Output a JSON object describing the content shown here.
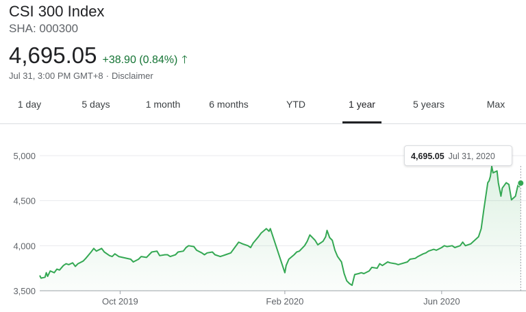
{
  "header": {
    "title": "CSI 300 Index",
    "ticker": "SHA: 000300",
    "price": "4,695.05",
    "change": "+38.90 (0.84%)",
    "timestamp": "Jul 31, 3:00 PM GMT+8",
    "separator": "·",
    "disclaimer": "Disclaimer"
  },
  "tabs": [
    {
      "label": "1 day",
      "active": false
    },
    {
      "label": "5 days",
      "active": false
    },
    {
      "label": "1 month",
      "active": false
    },
    {
      "label": "6 months",
      "active": false
    },
    {
      "label": "YTD",
      "active": false
    },
    {
      "label": "1 year",
      "active": true
    },
    {
      "label": "5 years",
      "active": false
    },
    {
      "label": "Max",
      "active": false
    }
  ],
  "tooltip": {
    "value": "4,695.05",
    "date": "Jul 31, 2020"
  },
  "colors": {
    "line": "#34a853",
    "positive": "#137333"
  },
  "chart_data": {
    "type": "area",
    "ylim": [
      3500,
      5000
    ],
    "y_ticks": [
      {
        "value": 5000,
        "label": "5,000"
      },
      {
        "value": 4500,
        "label": "4,500"
      },
      {
        "value": 4000,
        "label": "4,000"
      },
      {
        "value": 3500,
        "label": "3,500"
      }
    ],
    "x_range": [
      "2019-08-01",
      "2020-08-04"
    ],
    "x_ticks": [
      {
        "date": "2019-10-01",
        "label": "Oct 2019"
      },
      {
        "date": "2020-02-03",
        "label": "Feb 2020"
      },
      {
        "date": "2020-06-01",
        "label": "Jun 2020"
      }
    ],
    "grid": true,
    "series": [
      {
        "points": [
          [
            "2019-08-01",
            3670
          ],
          [
            "2019-08-02",
            3640
          ],
          [
            "2019-08-05",
            3650
          ],
          [
            "2019-08-06",
            3700
          ],
          [
            "2019-08-07",
            3660
          ],
          [
            "2019-08-09",
            3720
          ],
          [
            "2019-08-12",
            3700
          ],
          [
            "2019-08-14",
            3740
          ],
          [
            "2019-08-16",
            3730
          ],
          [
            "2019-08-19",
            3780
          ],
          [
            "2019-08-21",
            3800
          ],
          [
            "2019-08-23",
            3790
          ],
          [
            "2019-08-26",
            3810
          ],
          [
            "2019-08-28",
            3770
          ],
          [
            "2019-08-30",
            3800
          ],
          [
            "2019-09-03",
            3830
          ],
          [
            "2019-09-05",
            3860
          ],
          [
            "2019-09-09",
            3930
          ],
          [
            "2019-09-11",
            3970
          ],
          [
            "2019-09-13",
            3940
          ],
          [
            "2019-09-17",
            3970
          ],
          [
            "2019-09-19",
            3930
          ],
          [
            "2019-09-23",
            3890
          ],
          [
            "2019-09-25",
            3880
          ],
          [
            "2019-09-27",
            3910
          ],
          [
            "2019-09-30",
            3880
          ],
          [
            "2019-10-09",
            3850
          ],
          [
            "2019-10-11",
            3820
          ],
          [
            "2019-10-15",
            3850
          ],
          [
            "2019-10-17",
            3880
          ],
          [
            "2019-10-21",
            3870
          ],
          [
            "2019-10-23",
            3900
          ],
          [
            "2019-10-25",
            3930
          ],
          [
            "2019-10-29",
            3940
          ],
          [
            "2019-10-31",
            3890
          ],
          [
            "2019-11-04",
            3900
          ],
          [
            "2019-11-06",
            3900
          ],
          [
            "2019-11-08",
            3880
          ],
          [
            "2019-11-12",
            3900
          ],
          [
            "2019-11-14",
            3930
          ],
          [
            "2019-11-18",
            3940
          ],
          [
            "2019-11-20",
            3980
          ],
          [
            "2019-11-22",
            4000
          ],
          [
            "2019-11-26",
            3990
          ],
          [
            "2019-11-28",
            3950
          ],
          [
            "2019-12-02",
            3920
          ],
          [
            "2019-12-04",
            3900
          ],
          [
            "2019-12-06",
            3920
          ],
          [
            "2019-12-10",
            3930
          ],
          [
            "2019-12-12",
            3900
          ],
          [
            "2019-12-16",
            3880
          ],
          [
            "2019-12-18",
            3890
          ],
          [
            "2019-12-20",
            3900
          ],
          [
            "2019-12-24",
            3920
          ],
          [
            "2019-12-26",
            3960
          ],
          [
            "2019-12-30",
            4040
          ],
          [
            "2020-01-02",
            4020
          ],
          [
            "2020-01-06",
            4000
          ],
          [
            "2020-01-08",
            3980
          ],
          [
            "2020-01-10",
            4030
          ],
          [
            "2020-01-14",
            4100
          ],
          [
            "2020-01-16",
            4140
          ],
          [
            "2020-01-20",
            4190
          ],
          [
            "2020-01-22",
            4160
          ],
          [
            "2020-01-23",
            4190
          ],
          [
            "2020-02-03",
            3700
          ],
          [
            "2020-02-04",
            3780
          ],
          [
            "2020-02-06",
            3850
          ],
          [
            "2020-02-10",
            3900
          ],
          [
            "2020-02-12",
            3930
          ],
          [
            "2020-02-14",
            3940
          ],
          [
            "2020-02-18",
            4000
          ],
          [
            "2020-02-20",
            4050
          ],
          [
            "2020-02-22",
            4120
          ],
          [
            "2020-02-26",
            4060
          ],
          [
            "2020-02-28",
            4010
          ],
          [
            "2020-03-03",
            4050
          ],
          [
            "2020-03-05",
            4100
          ],
          [
            "2020-03-06",
            4170
          ],
          [
            "2020-03-08",
            4090
          ],
          [
            "2020-03-10",
            4060
          ],
          [
            "2020-03-12",
            3950
          ],
          [
            "2020-03-14",
            3880
          ],
          [
            "2020-03-17",
            3820
          ],
          [
            "2020-03-19",
            3690
          ],
          [
            "2020-03-21",
            3610
          ],
          [
            "2020-03-23",
            3580
          ],
          [
            "2020-03-25",
            3560
          ],
          [
            "2020-03-27",
            3680
          ],
          [
            "2020-03-30",
            3690
          ],
          [
            "2020-04-01",
            3700
          ],
          [
            "2020-04-03",
            3690
          ],
          [
            "2020-04-07",
            3720
          ],
          [
            "2020-04-09",
            3760
          ],
          [
            "2020-04-13",
            3750
          ],
          [
            "2020-04-15",
            3800
          ],
          [
            "2020-04-17",
            3780
          ],
          [
            "2020-04-21",
            3820
          ],
          [
            "2020-04-23",
            3810
          ],
          [
            "2020-04-27",
            3800
          ],
          [
            "2020-04-29",
            3790
          ],
          [
            "2020-05-06",
            3820
          ],
          [
            "2020-05-08",
            3850
          ],
          [
            "2020-05-12",
            3860
          ],
          [
            "2020-05-14",
            3880
          ],
          [
            "2020-05-18",
            3910
          ],
          [
            "2020-05-20",
            3920
          ],
          [
            "2020-05-22",
            3940
          ],
          [
            "2020-05-26",
            3960
          ],
          [
            "2020-05-28",
            3950
          ],
          [
            "2020-06-01",
            3980
          ],
          [
            "2020-06-03",
            4000
          ],
          [
            "2020-06-05",
            3990
          ],
          [
            "2020-06-09",
            4000
          ],
          [
            "2020-06-11",
            3980
          ],
          [
            "2020-06-15",
            4000
          ],
          [
            "2020-06-17",
            4040
          ],
          [
            "2020-06-19",
            4000
          ],
          [
            "2020-06-23",
            4020
          ],
          [
            "2020-06-29",
            4100
          ],
          [
            "2020-07-01",
            4190
          ],
          [
            "2020-07-03",
            4400
          ],
          [
            "2020-07-06",
            4700
          ],
          [
            "2020-07-07",
            4720
          ],
          [
            "2020-07-08",
            4770
          ],
          [
            "2020-07-09",
            4880
          ],
          [
            "2020-07-10",
            4810
          ],
          [
            "2020-07-13",
            4830
          ],
          [
            "2020-07-14",
            4700
          ],
          [
            "2020-07-16",
            4550
          ],
          [
            "2020-07-17",
            4640
          ],
          [
            "2020-07-20",
            4700
          ],
          [
            "2020-07-22",
            4680
          ],
          [
            "2020-07-24",
            4510
          ],
          [
            "2020-07-27",
            4550
          ],
          [
            "2020-07-29",
            4680
          ],
          [
            "2020-07-30",
            4656
          ],
          [
            "2020-07-31",
            4695.05
          ]
        ]
      }
    ]
  }
}
